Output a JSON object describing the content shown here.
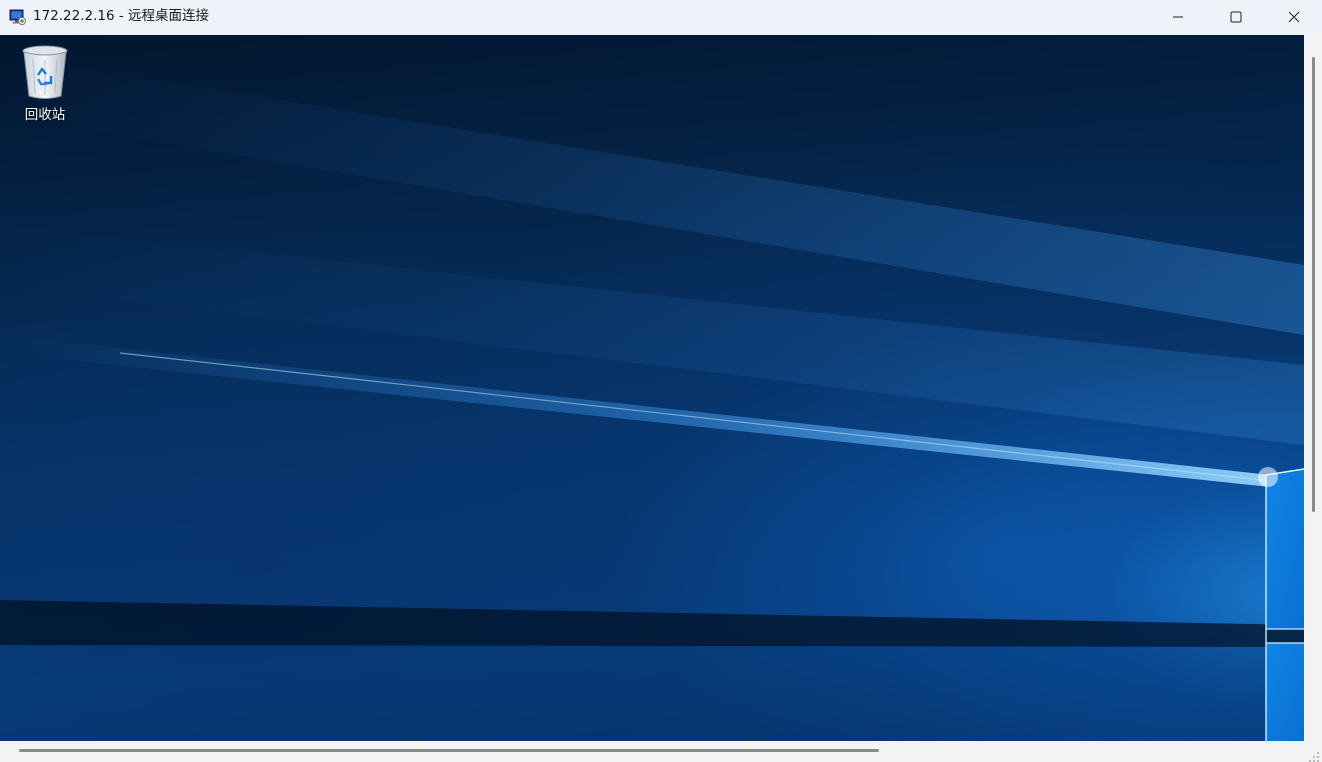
{
  "window": {
    "title": "172.22.2.16 - 远程桌面连接",
    "app_icon": "remote-desktop-icon",
    "controls": {
      "minimize_icon": "minimize-icon",
      "maximize_icon": "maximize-icon",
      "close_icon": "close-icon"
    }
  },
  "desktop": {
    "wallpaper": "windows-10-hero",
    "icons": [
      {
        "label": "回收站",
        "icon": "recycle-bin-icon"
      }
    ]
  },
  "colors": {
    "titlebar_bg": "#eef2f9",
    "wallpaper_dark": "#02162f",
    "wallpaper_accent": "#1e8ce6",
    "scrollbar_thumb": "#8a8a8a"
  }
}
